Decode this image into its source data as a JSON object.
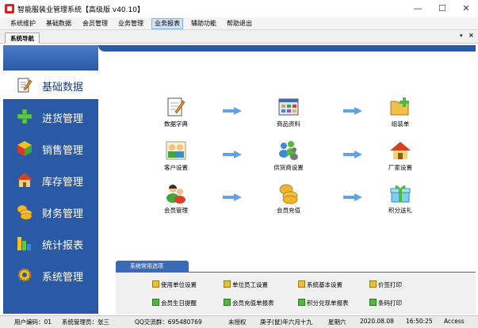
{
  "window": {
    "title": "智能服装业管理系统【高级版 v40.10】",
    "controls": {
      "minimize": "—",
      "maximize": "☐",
      "close": "✕"
    }
  },
  "menu": [
    "系统维护",
    "基础数据",
    "会员管理",
    "业务管理",
    "业务报表",
    "辅助功能",
    "帮助退出"
  ],
  "menu_active_index": 4,
  "tabs": {
    "label": "系统导航",
    "dropdown": "▾",
    "close": "×"
  },
  "sidebar": {
    "header": "",
    "items": [
      {
        "label": "基础数据",
        "icon": "edit-document-icon",
        "selected": true
      },
      {
        "label": "进货管理",
        "icon": "plus-icon",
        "selected": false
      },
      {
        "label": "销售管理",
        "icon": "cube-icon",
        "selected": false
      },
      {
        "label": "库存管理",
        "icon": "house-icon",
        "selected": false
      },
      {
        "label": "财务管理",
        "icon": "coins-icon",
        "selected": false
      },
      {
        "label": "统计报表",
        "icon": "bar-chart-icon",
        "selected": false
      },
      {
        "label": "系统管理",
        "icon": "gear-icon",
        "selected": false
      }
    ]
  },
  "functions": [
    {
      "label": "数据字典",
      "icon": "dictionary-icon"
    },
    {
      "label": "商品资料",
      "icon": "goods-window-icon"
    },
    {
      "label": "组装单",
      "icon": "folder-add-icon"
    },
    {
      "label": "客户设置",
      "icon": "customers-icon"
    },
    {
      "label": "供货商设置",
      "icon": "suppliers-icon"
    },
    {
      "label": "厂家设置",
      "icon": "factory-house-icon"
    },
    {
      "label": "会员管理",
      "icon": "members-icon"
    },
    {
      "label": "会员充值",
      "icon": "coins-icon"
    },
    {
      "label": "积分送礼",
      "icon": "gift-icon"
    }
  ],
  "common": {
    "title": "系统常用选项",
    "links": [
      {
        "label": "使用单位设置",
        "icon": "setting-icon"
      },
      {
        "label": "单位员工设置",
        "icon": "setting-icon"
      },
      {
        "label": "系统基本设置",
        "icon": "setting-icon"
      },
      {
        "label": "价签打印",
        "icon": "setting-icon"
      },
      {
        "label": "会员生日提醒",
        "icon": "report-icon"
      },
      {
        "label": "会员充值单报表",
        "icon": "report-icon"
      },
      {
        "label": "积分兑现单报表",
        "icon": "report-icon"
      },
      {
        "label": "条码打印",
        "icon": "report-icon"
      }
    ]
  },
  "status": [
    "用户编码：01",
    "系统管理员：张三",
    "QQ交流群：695480769",
    "未授权",
    "庚子(鼠)年六月十九",
    "星期六",
    "2020.08.08",
    "16:50:25",
    "Access"
  ],
  "colors": {
    "sidebar": "#2a5aa6",
    "accent": "#3b6bb8",
    "menu_active": "#cfe4f8"
  }
}
